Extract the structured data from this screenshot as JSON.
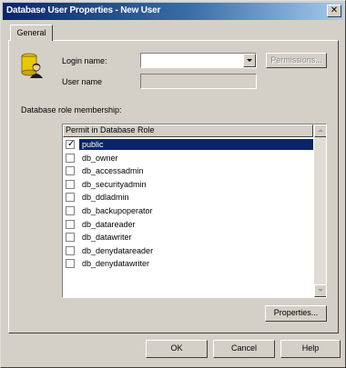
{
  "window": {
    "title": "Database User Properties - New User",
    "close_glyph": "✕"
  },
  "tabs": [
    {
      "label": "General"
    }
  ],
  "form": {
    "login_label": "Login name:",
    "login_value": "",
    "permissions_button": "Permissions...",
    "username_label": "User name",
    "username_value": ""
  },
  "roles": {
    "section_label": "Database role membership:",
    "column_header": "Permit in Database Role",
    "items": [
      {
        "name": "public",
        "checked": true,
        "selected": true
      },
      {
        "name": "db_owner",
        "checked": false,
        "selected": false
      },
      {
        "name": "db_accessadmin",
        "checked": false,
        "selected": false
      },
      {
        "name": "db_securityadmin",
        "checked": false,
        "selected": false
      },
      {
        "name": "db_ddladmin",
        "checked": false,
        "selected": false
      },
      {
        "name": "db_backupoperator",
        "checked": false,
        "selected": false
      },
      {
        "name": "db_datareader",
        "checked": false,
        "selected": false
      },
      {
        "name": "db_datawriter",
        "checked": false,
        "selected": false
      },
      {
        "name": "db_denydatareader",
        "checked": false,
        "selected": false
      },
      {
        "name": "db_denydatawriter",
        "checked": false,
        "selected": false
      }
    ],
    "properties_button": "Properties..."
  },
  "footer": {
    "ok": "OK",
    "cancel": "Cancel",
    "help": "Help"
  },
  "colors": {
    "selection": "#0a246a",
    "dialog_face": "#d4d0c8"
  },
  "icons": {
    "user": "user-database-icon",
    "check": "checkmark-icon"
  }
}
